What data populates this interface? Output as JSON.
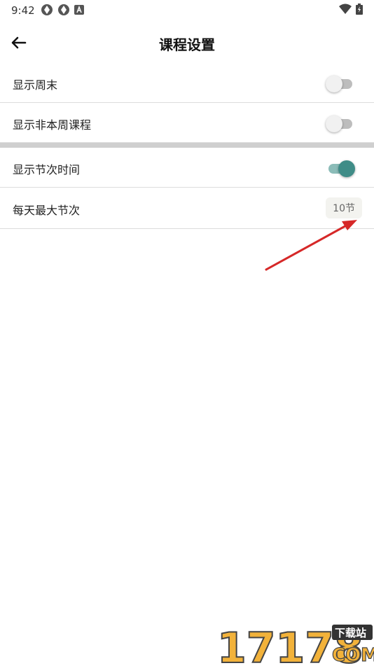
{
  "status_bar": {
    "time": "9:42"
  },
  "header": {
    "title": "课程设置"
  },
  "settings": [
    {
      "label": "显示周末",
      "toggle": "off"
    },
    {
      "label": "显示非本周课程",
      "toggle": "off"
    },
    {
      "label": "显示节次时间",
      "toggle": "on"
    },
    {
      "label": "每天最大节次",
      "value": "10节"
    }
  ],
  "accent_color": "#3f8c87",
  "watermark": {
    "text": "17178",
    "badge": "下载站",
    "domain": "COM"
  }
}
